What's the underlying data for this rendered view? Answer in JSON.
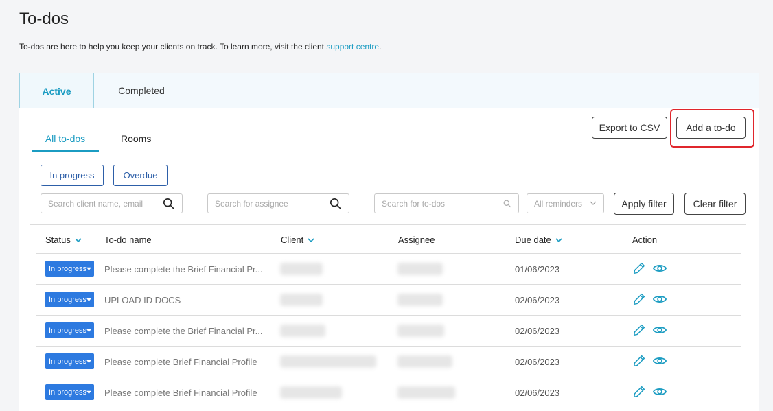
{
  "page": {
    "title": "To-dos",
    "subtitle_prefix": "To-dos are here to help you keep your clients on track. To learn more, visit the client ",
    "subtitle_link": "support centre",
    "subtitle_suffix": "."
  },
  "panel_tabs": {
    "active": "Active",
    "completed": "Completed"
  },
  "sub_tabs": {
    "all": "All to-dos",
    "rooms": "Rooms"
  },
  "toolbar": {
    "export": "Export to CSV",
    "add": "Add a to-do"
  },
  "chips": {
    "in_progress": "In progress",
    "overdue": "Overdue"
  },
  "filters": {
    "client_placeholder": "Search client name, email",
    "assignee_placeholder": "Search for assignee",
    "todo_placeholder": "Search for to-dos",
    "reminders": "All reminders",
    "apply": "Apply filter",
    "clear": "Clear filter"
  },
  "table": {
    "headers": {
      "status": "Status",
      "name": "To-do name",
      "client": "Client",
      "assignee": "Assignee",
      "due": "Due date",
      "action": "Action"
    },
    "rows": [
      {
        "status": "In progress",
        "name": "Please complete the Brief Financial Pr...",
        "due": "01/06/2023"
      },
      {
        "status": "In progress",
        "name": "UPLOAD ID DOCS",
        "due": "02/06/2023"
      },
      {
        "status": "In progress",
        "name": "Please complete the Brief Financial Pr...",
        "due": "02/06/2023"
      },
      {
        "status": "In progress",
        "name": "Please complete Brief Financial Profile",
        "due": "02/06/2023"
      },
      {
        "status": "In progress",
        "name": "Please complete Brief Financial Profile",
        "due": "02/06/2023"
      }
    ]
  },
  "colors": {
    "accent": "#1b9cc2",
    "badge": "#2d7ae0",
    "highlight": "#e0262c",
    "chip": "#2d5fa8"
  },
  "icons": {
    "search": "search-icon",
    "edit": "pencil-icon",
    "view": "eye-icon",
    "sort": "chevron-down-icon"
  }
}
